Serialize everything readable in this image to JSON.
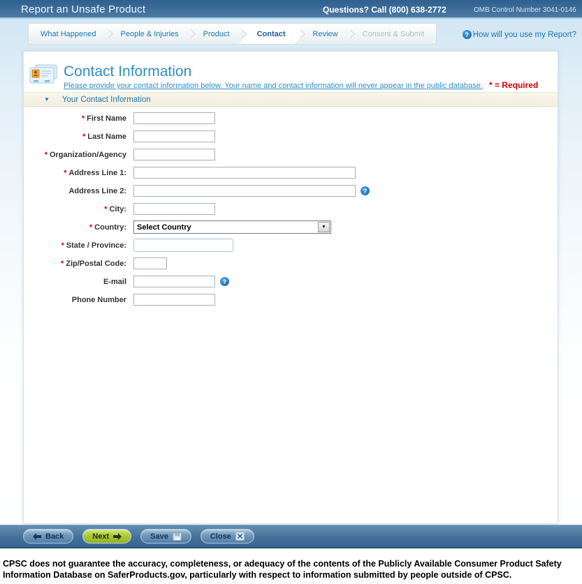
{
  "header": {
    "title": "Report an Unsafe Product",
    "questions": "Questions? Call (800) 638-2772",
    "omb": "OMB Control Number 3041-0146"
  },
  "wizard": {
    "steps": [
      {
        "label": "What Happened",
        "state": "normal"
      },
      {
        "label": "People & Injuries",
        "state": "normal"
      },
      {
        "label": "Product",
        "state": "normal"
      },
      {
        "label": "Contact",
        "state": "active"
      },
      {
        "label": "Review",
        "state": "normal"
      },
      {
        "label": "Consent & Submit",
        "state": "disabled"
      }
    ],
    "help_icon": "?",
    "help_label": "How will you use my Report?"
  },
  "page": {
    "title": "Contact Information",
    "subtitle": "Please provide your contact information below. Your name and contact information will never appear in the public database.",
    "required_note": "* = Required",
    "collapse_icon": "▼",
    "section_title": "Your Contact Information"
  },
  "form": {
    "fields": [
      {
        "mark": "*",
        "label": "First Name",
        "value": ""
      },
      {
        "mark": "*",
        "label": "Last Name",
        "value": ""
      },
      {
        "mark": "*",
        "label": "Organization/Agency",
        "value": ""
      },
      {
        "mark": "*",
        "label": "Address Line 1:",
        "value": ""
      },
      {
        "mark": "",
        "label": "Address Line 2:",
        "value": "",
        "help": "?"
      },
      {
        "mark": "*",
        "label": "City:",
        "value": ""
      },
      {
        "mark": "*",
        "label": "Country:",
        "value": "Select Country",
        "dropdown_icon": "▼"
      },
      {
        "mark": "*",
        "label": "State / Province:",
        "value": ""
      },
      {
        "mark": "*",
        "label": "Zip/Postal Code:",
        "value": ""
      },
      {
        "mark": "",
        "label": "E-mail",
        "value": "",
        "help": "?"
      },
      {
        "mark": "",
        "label": "Phone Number",
        "value": ""
      }
    ]
  },
  "toolbar": {
    "back": "Back",
    "next": "Next",
    "save": "Save",
    "close": "Close"
  },
  "footer": {
    "disclaimer": "CPSC does not guarantee the accuracy, completeness, or adequacy of the contents of the Publicly Available Consumer Product Safety Information Database on SaferProducts.gov, particularly with respect to information submitted by people outside of CPSC."
  },
  "colors": {
    "header_blue": "#2e5f8e",
    "accent_blue": "#1c76ae",
    "title_blue": "#2e8ec6",
    "required_red": "#cc0000",
    "section_cream": "#f6f3e6",
    "next_green": "#a8c832"
  }
}
